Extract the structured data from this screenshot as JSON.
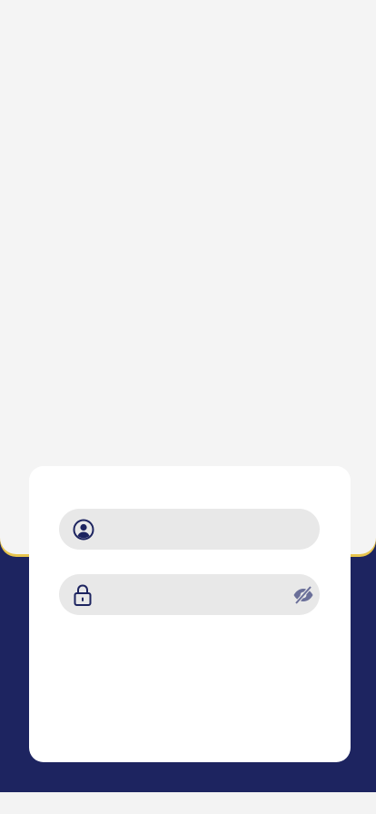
{
  "colors": {
    "navy": "#1d2460",
    "accent_yellow": "#e7c44d",
    "background": "#f4f4f4",
    "card": "#ffffff",
    "field_bg": "#e8e8e8"
  },
  "login_form": {
    "username": {
      "value": "",
      "placeholder": "",
      "icon": "user-circle-icon"
    },
    "password": {
      "value": "",
      "placeholder": "",
      "icon": "lock-icon",
      "toggle_icon": "eye-off-icon"
    }
  }
}
